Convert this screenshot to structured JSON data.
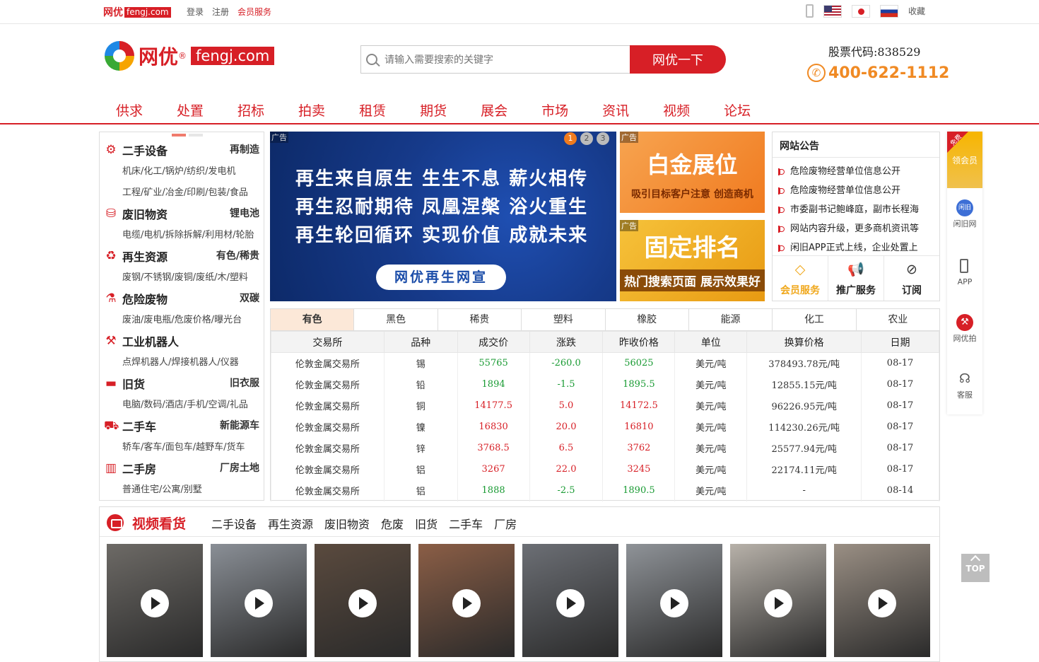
{
  "topbar": {
    "logo_text": "网优",
    "logo_domain": "fengj.com",
    "links": [
      "登录",
      "注册",
      "会员服务"
    ],
    "favorite": "收藏"
  },
  "header": {
    "logo_text": "网优",
    "logo_reg": "®",
    "logo_domain": "fengj.com",
    "search_placeholder": "请输入需要搜索的关键字",
    "search_button": "网优一下",
    "stock_code": "股票代码:838529",
    "hotline": "400-622-1112"
  },
  "nav": [
    "供求",
    "处置",
    "招标",
    "拍卖",
    "租赁",
    "期货",
    "展会",
    "市场",
    "资讯",
    "视频",
    "论坛"
  ],
  "categories": [
    {
      "name": "二手设备",
      "right": "再制造",
      "sub": "机床/化工/锅炉/纺织/发电机",
      "sub2": "工程/矿业/冶金/印刷/包装/食品",
      "icon": "gears-icon"
    },
    {
      "name": "废旧物资",
      "right": "锂电池",
      "sub": "电缆/电机/拆除拆解/利用材/轮胎",
      "icon": "scrap-icon"
    },
    {
      "name": "再生资源",
      "right": "有色/稀贵",
      "sub": "废钢/不锈钢/废铜/废纸/木/塑料",
      "icon": "recycle-icon"
    },
    {
      "name": "危险废物",
      "right": "双碳",
      "sub": "废油/废电瓶/危废价格/曝光台",
      "icon": "flask-icon"
    },
    {
      "name": "工业机器人",
      "right": "",
      "sub": "点焊机器人/焊接机器人/仪器",
      "icon": "robot-arm-icon"
    },
    {
      "name": "旧货",
      "right": "旧衣服",
      "sub": "电脑/数码/酒店/手机/空调/礼品",
      "icon": "sofa-icon"
    },
    {
      "name": "二手车",
      "right": "新能源车",
      "sub": "轿车/客车/面包车/越野车/货车",
      "icon": "truck-icon"
    },
    {
      "name": "二手房",
      "right": "厂房土地",
      "sub": "普通住宅/公寓/别墅",
      "icon": "building-icon"
    }
  ],
  "banner": {
    "ad_label": "广告",
    "lines": [
      "再生来自原生 生生不息 薪火相传",
      "再生忍耐期待 凤凰涅槃 浴火重生",
      "再生轮回循环 实现价值 成就未来"
    ],
    "pill": "网优再生网宣",
    "dots": [
      "1",
      "2",
      "3"
    ]
  },
  "side_ads": [
    {
      "label": "广告",
      "title": "白金展位",
      "sub": "吸引目标客户注意 创造商机"
    },
    {
      "label": "广告",
      "title": "固定排名",
      "sub": "热门搜索页面 展示效果好"
    }
  ],
  "notice": {
    "title": "网站公告",
    "items": [
      "危险废物经营单位信息公开",
      "危险废物经营单位信息公开",
      "市委副书记鲍峰庭，副市长程海",
      "网站内容升级，更多商机资讯等",
      "闲旧APP正式上线，企业处置上"
    ],
    "services": [
      "会员服务",
      "推广服务",
      "订阅"
    ]
  },
  "market": {
    "tabs": [
      "有色",
      "黑色",
      "稀贵",
      "塑料",
      "橡胶",
      "能源",
      "化工",
      "农业"
    ],
    "headers": [
      "交易所",
      "品种",
      "成交价",
      "涨跌",
      "昨收价格",
      "单位",
      "换算价格",
      "日期"
    ],
    "rows": [
      {
        "ex": "伦敦金属交易所",
        "item": "锡",
        "price": "55765",
        "chg": "-260.0",
        "prev": "56025",
        "unit": "美元/吨",
        "conv": "378493.78元/吨",
        "date": "08-17",
        "trend": "g"
      },
      {
        "ex": "伦敦金属交易所",
        "item": "铅",
        "price": "1894",
        "chg": "-1.5",
        "prev": "1895.5",
        "unit": "美元/吨",
        "conv": "12855.15元/吨",
        "date": "08-17",
        "trend": "g"
      },
      {
        "ex": "伦敦金属交易所",
        "item": "铜",
        "price": "14177.5",
        "chg": "5.0",
        "prev": "14172.5",
        "unit": "美元/吨",
        "conv": "96226.95元/吨",
        "date": "08-17",
        "trend": "r"
      },
      {
        "ex": "伦敦金属交易所",
        "item": "镍",
        "price": "16830",
        "chg": "20.0",
        "prev": "16810",
        "unit": "美元/吨",
        "conv": "114230.26元/吨",
        "date": "08-17",
        "trend": "r"
      },
      {
        "ex": "伦敦金属交易所",
        "item": "锌",
        "price": "3768.5",
        "chg": "6.5",
        "prev": "3762",
        "unit": "美元/吨",
        "conv": "25577.94元/吨",
        "date": "08-17",
        "trend": "r"
      },
      {
        "ex": "伦敦金属交易所",
        "item": "铝",
        "price": "3267",
        "chg": "22.0",
        "prev": "3245",
        "unit": "美元/吨",
        "conv": "22174.11元/吨",
        "date": "08-17",
        "trend": "r"
      },
      {
        "ex": "伦敦金属交易所",
        "item": "铝",
        "price": "1888",
        "chg": "-2.5",
        "prev": "1890.5",
        "unit": "美元/吨",
        "conv": "-",
        "date": "08-14",
        "trend": "g"
      }
    ]
  },
  "video": {
    "title": "视频看货",
    "tabs": [
      "二手设备",
      "再生资源",
      "废旧物资",
      "危废",
      "旧货",
      "二手车",
      "厂房"
    ],
    "thumbs": [
      "#6d6a66",
      "#8a8f96",
      "#5a4a3e",
      "#8b5e46",
      "#6c6f75",
      "#8f9398",
      "#b7b1a9",
      "#9a8f84"
    ]
  },
  "right_bar": {
    "vip_free": "免费",
    "vip_label": "领会员",
    "items": [
      "闲旧网",
      "APP",
      "网优拍",
      "客服"
    ]
  },
  "top_button": "TOP",
  "colors": {
    "brand": "#d71f26",
    "accent": "#f08a24",
    "rise": "#d71f26",
    "fall": "#189a32"
  }
}
